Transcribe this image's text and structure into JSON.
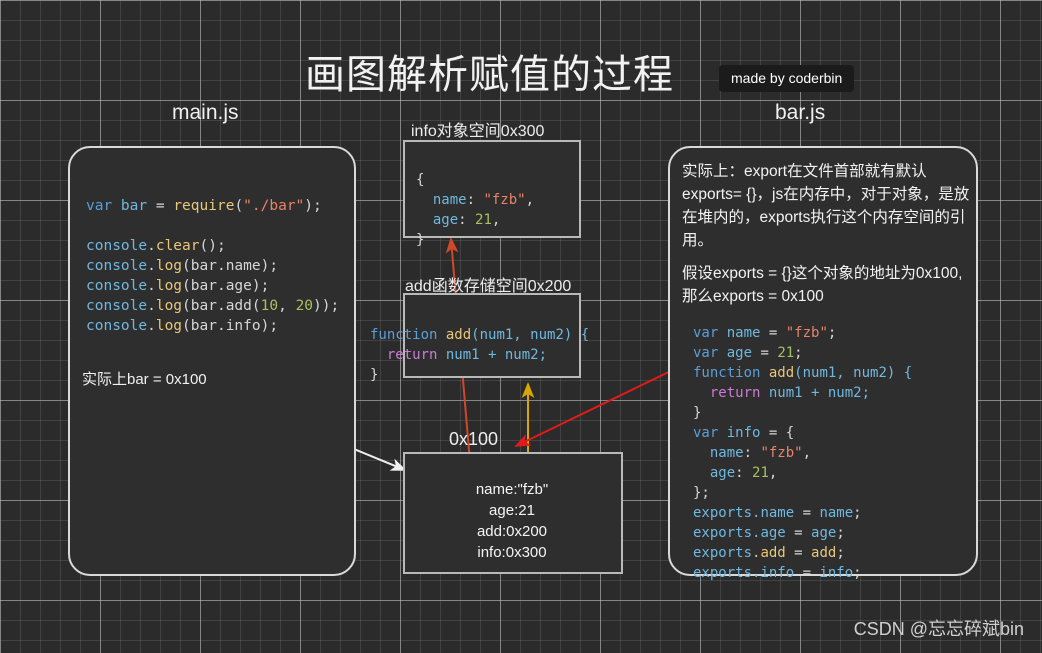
{
  "page": {
    "title": "画图解析赋值的过程",
    "badge": "made by coderbin",
    "watermark": "CSDN @忘忘碎斌bin"
  },
  "labels": {
    "main_js": "main.js",
    "bar_js": "bar.js",
    "info_box": "info对象空间0x300",
    "add_box": "add函数存储空间0x200",
    "heap_box": "0x100"
  },
  "main_js_code": {
    "line1_kw": "var",
    "line1_id": " bar ",
    "line1_eq": "= ",
    "line1_fn": "require",
    "line1_open": "(",
    "line1_str": "\"./bar\"",
    "line1_close": ");",
    "line3_obj": "console",
    "line3_dot": ".",
    "line3_fn": "clear",
    "line3_rest": "();",
    "line4_fn": "log",
    "line4_arg": "(bar.name);",
    "line5_fn": "log",
    "line5_arg": "(bar.age);",
    "line6_fn": "log",
    "line6_arg_a": "(bar.add(",
    "line6_num1": "10",
    "line6_comma": ", ",
    "line6_num2": "20",
    "line6_arg_b": "));",
    "line7_fn": "log",
    "line7_arg": "(bar.info);"
  },
  "main_js_annotation": "实际上bar = 0x100",
  "info_object_code": {
    "l1": "{",
    "l2_key": "  name",
    "l2_colon": ": ",
    "l2_val": "\"fzb\"",
    "l2_end": ",",
    "l3_key": "  age",
    "l3_colon": ": ",
    "l3_val": "21",
    "l3_end": ",",
    "l4": "}"
  },
  "add_function_code": {
    "l1_kw": "function ",
    "l1_name": "add",
    "l1_args": "(num1, num2) {",
    "l2_kw": "  return ",
    "l2_body": "num1 + num2;",
    "l3": "}"
  },
  "heap_contents": [
    "name:\"fzb\"",
    "age:21",
    "add:0x200",
    "info:0x300"
  ],
  "bar_js_notes": {
    "paragraph1": "实际上：export在文件首部就有默认exports= {}，js在内存中，对于对象，是放在堆内的，exports执行这个内存空间的引用。",
    "paragraph2": "假设exports = {}这个对象的地址为0x100,那么exports = 0x100"
  },
  "bar_js_code": {
    "l1_kw": "var",
    "l1_id": " name ",
    "l1_eq": "= ",
    "l1_str": "\"fzb\"",
    "l1_end": ";",
    "l2_kw": "var",
    "l2_id": " age ",
    "l2_eq": "= ",
    "l2_num": "21",
    "l2_end": ";",
    "l3_kw": "function ",
    "l3_name": "add",
    "l3_args": "(num1, num2) {",
    "l4_kw": "  return ",
    "l4_body": "num1 + num2;",
    "l5": "}",
    "l6_kw": "var",
    "l6_id": " info ",
    "l6_eq": "= {",
    "l7_key": "  name",
    "l7_colon": ": ",
    "l7_val": "\"fzb\"",
    "l7_end": ",",
    "l8_key": "  age",
    "l8_colon": ": ",
    "l8_val": "21",
    "l8_end": ",",
    "l9": "};",
    "l10_obj": "exports",
    "l10_prop": ".name ",
    "l10_eq": "= ",
    "l10_val": "name",
    "l10_end": ";",
    "l11_obj": "exports",
    "l11_prop": ".age ",
    "l11_eq": "= ",
    "l11_val": "age",
    "l11_end": ";",
    "l12_obj": "exports",
    "l12_prop": ".add ",
    "l12_eq": "= ",
    "l12_val": "add",
    "l12_end": ";",
    "l13_obj": "exports",
    "l13_prop": ".info ",
    "l13_eq": "= ",
    "l13_val": "info",
    "l13_end": ";"
  },
  "colors": {
    "background": "#2b2b2b",
    "panel_border": "#d9d9d9",
    "arrow_white": "#f0f0f0",
    "arrow_orange": "#d2472a",
    "arrow_gold": "#d8a706",
    "arrow_red": "#e01b1b"
  }
}
